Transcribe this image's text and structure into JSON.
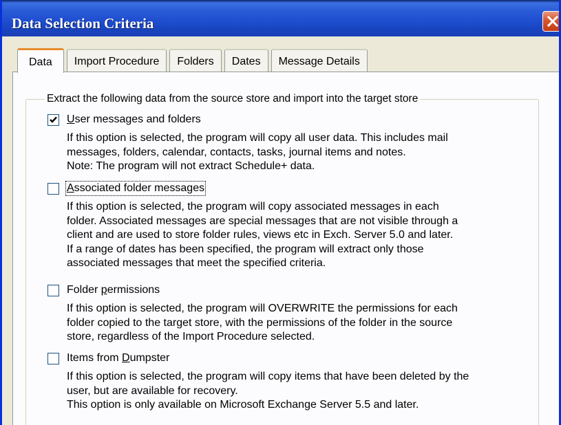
{
  "window": {
    "title": "Data Selection Criteria"
  },
  "tabs": [
    {
      "label": "Data",
      "active": true
    },
    {
      "label": "Import Procedure",
      "active": false
    },
    {
      "label": "Folders",
      "active": false
    },
    {
      "label": "Dates",
      "active": false
    },
    {
      "label": "Message Details",
      "active": false
    }
  ],
  "group": {
    "legend": "Extract the following data from the source store and import into the target store"
  },
  "options": [
    {
      "label_pre": "",
      "label_key": "U",
      "label_post": "ser messages and folders",
      "checked": true,
      "description": [
        "If this option is selected, the program will copy all user data. This includes mail",
        "messages, folders, calendar, contacts, tasks, journal items and notes.",
        "Note: The program will not extract Schedule+ data."
      ]
    },
    {
      "label_pre": "",
      "label_key": "A",
      "label_post": "ssociated folder messages",
      "checked": false,
      "description": [
        "If this option is selected, the program will copy associated messages in each",
        "folder. Associated messages are special messages that are not visible through a",
        "client and are used to store folder rules, views etc in Exch. Server 5.0 and later.",
        "If a range of dates has been specified, the program will extract only those",
        "associated messages that meet the specified criteria."
      ]
    },
    {
      "label_pre": "Folder ",
      "label_key": "p",
      "label_post": "ermissions",
      "checked": false,
      "description": [
        "If this option is selected, the program will OVERWRITE the permissions for each",
        "folder copied to the target store, with the permissions of the folder in the source",
        "store, regardless of the Import Procedure selected."
      ]
    },
    {
      "label_pre": "Items from ",
      "label_key": "D",
      "label_post": "umpster",
      "checked": false,
      "description": [
        "If this option is selected, the program will copy items that have been deleted by the",
        "user, but are available for recovery.",
        "This option is only available on Microsoft Exchange Server 5.5 and later."
      ]
    }
  ]
}
